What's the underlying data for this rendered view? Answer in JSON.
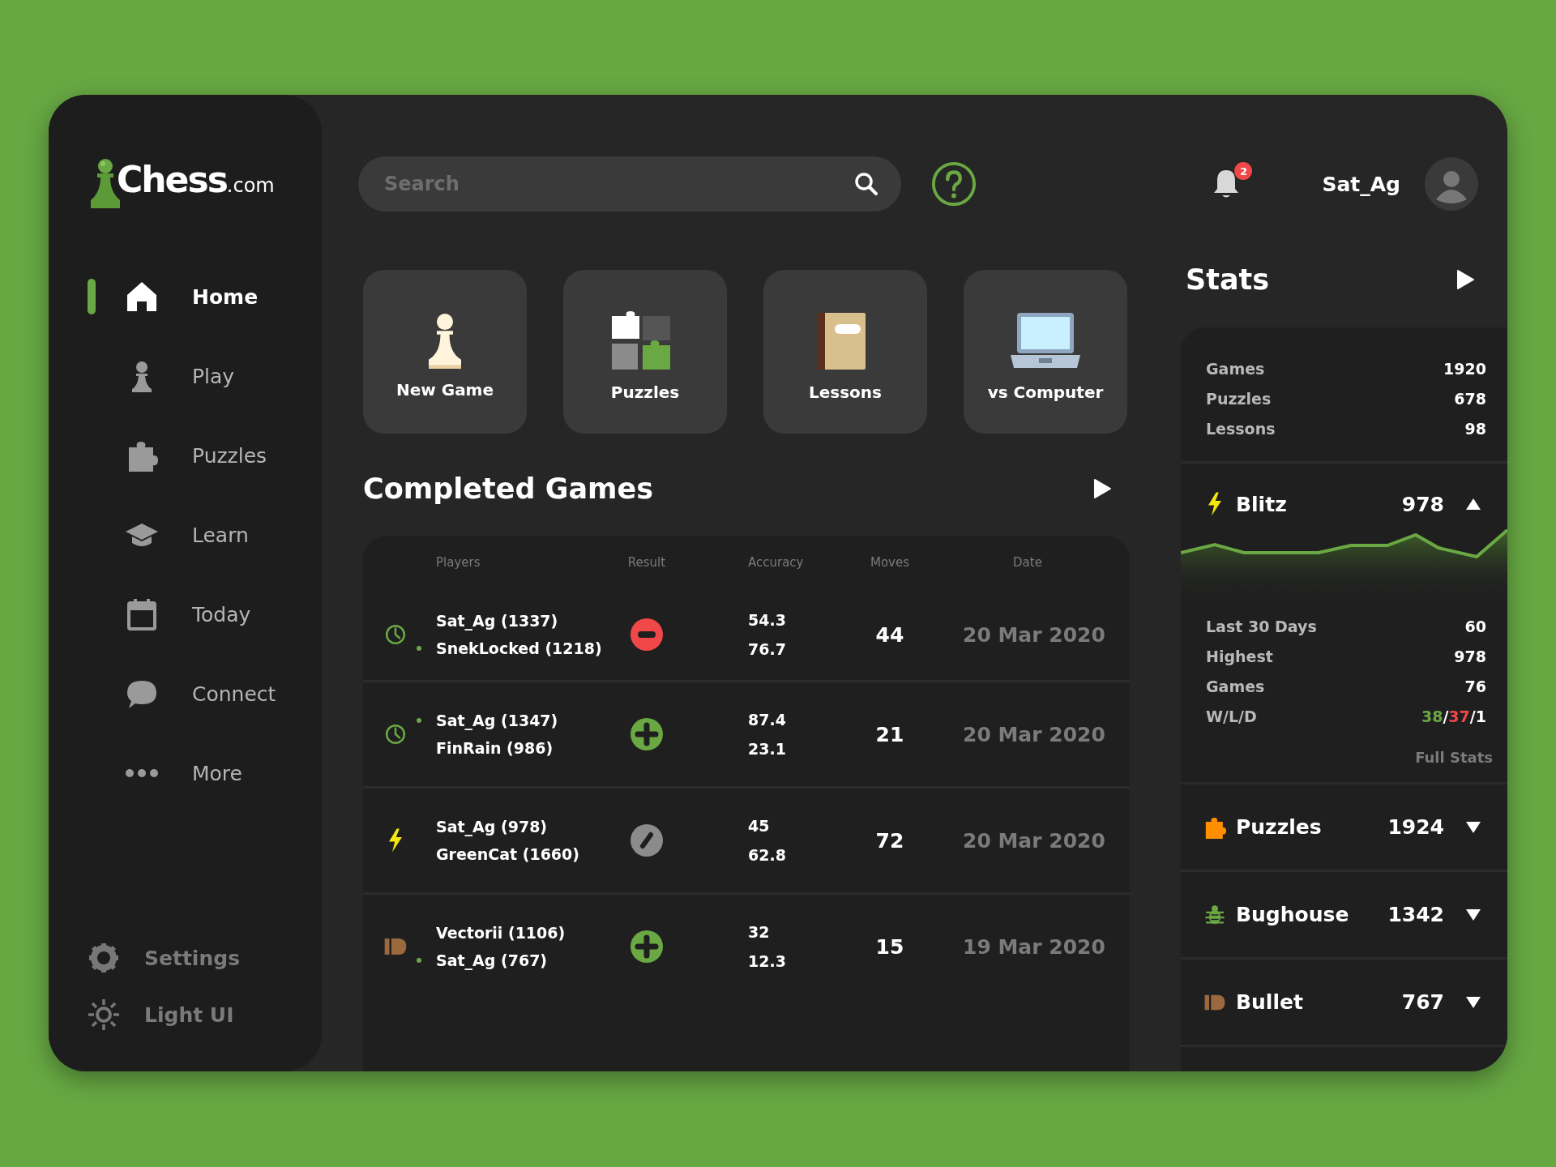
{
  "logo": {
    "name": "Chess",
    "suffix": ".com"
  },
  "nav": [
    {
      "label": "Home",
      "selected": true
    },
    {
      "label": "Play",
      "selected": false
    },
    {
      "label": "Puzzles",
      "selected": false
    },
    {
      "label": "Learn",
      "selected": false
    },
    {
      "label": "Today",
      "selected": false
    },
    {
      "label": "Connect",
      "selected": false
    },
    {
      "label": "More",
      "selected": false
    }
  ],
  "footer_nav": [
    {
      "label": "Settings"
    },
    {
      "label": "Light UI"
    }
  ],
  "search": {
    "placeholder": "Search"
  },
  "notifications": {
    "count": "2"
  },
  "user": {
    "name": "Sat_Ag"
  },
  "quick_actions": [
    {
      "label": "New Game"
    },
    {
      "label": "Puzzles"
    },
    {
      "label": "Lessons"
    },
    {
      "label": "vs Computer"
    }
  ],
  "completed_games": {
    "title": "Completed Games",
    "columns": [
      "Players",
      "Result",
      "Accuracy",
      "Moves",
      "Date"
    ],
    "rows": [
      {
        "kind": "rapid",
        "players": [
          {
            "name": "Sat_Ag (1337)",
            "marked": false
          },
          {
            "name": "SnekLocked (1218)",
            "marked": true
          }
        ],
        "result": {
          "kind": "loss"
        },
        "accuracy": [
          "54.3",
          "76.7"
        ],
        "moves": "44",
        "date": "20 Mar 2020"
      },
      {
        "kind": "rapid",
        "players": [
          {
            "name": "Sat_Ag (1347)",
            "marked": true
          },
          {
            "name": "FinRain (986)",
            "marked": false
          }
        ],
        "result": {
          "kind": "win"
        },
        "accuracy": [
          "87.4",
          "23.1"
        ],
        "moves": "21",
        "date": "20 Mar 2020"
      },
      {
        "kind": "blitz",
        "players": [
          {
            "name": "Sat_Ag (978)",
            "marked": false
          },
          {
            "name": "GreenCat (1660)",
            "marked": false
          }
        ],
        "result": {
          "kind": "draw"
        },
        "accuracy": [
          "45",
          "62.8"
        ],
        "moves": "72",
        "date": "20 Mar 2020"
      },
      {
        "kind": "bullet",
        "players": [
          {
            "name": "Vectorii (1106)",
            "marked": false
          },
          {
            "name": "Sat_Ag (767)",
            "marked": true
          }
        ],
        "result": {
          "kind": "win"
        },
        "accuracy": [
          "32",
          "12.3"
        ],
        "moves": "15",
        "date": "19 Mar 2020"
      }
    ]
  },
  "stats": {
    "title": "Stats",
    "summary": [
      {
        "label": "Games",
        "value": "1920"
      },
      {
        "label": "Puzzles",
        "value": "678"
      },
      {
        "label": "Lessons",
        "value": "98"
      }
    ],
    "modes": [
      {
        "kind": "blitz",
        "name": "Blitz",
        "rating": "978",
        "expanded": true,
        "details": [
          {
            "label": "Last 30 Days",
            "value": "60"
          },
          {
            "label": "Highest",
            "value": "978"
          },
          {
            "label": "Games",
            "value": "76"
          },
          {
            "label": "W/L/D",
            "parts": [
              {
                "text": "38",
                "color": "#6aa843"
              },
              {
                "text": "/",
                "color": "#ffffff"
              },
              {
                "text": "37",
                "color": "#f04848"
              },
              {
                "text": "/",
                "color": "#ffffff"
              },
              {
                "text": "1",
                "color": "#ffffff"
              }
            ]
          }
        ],
        "link": "Full Stats"
      },
      {
        "kind": "puzzles",
        "name": "Puzzles",
        "rating": "1924",
        "expanded": false
      },
      {
        "kind": "bughouse",
        "name": "Bughouse",
        "rating": "1342",
        "expanded": false
      },
      {
        "kind": "bullet",
        "name": "Bullet",
        "rating": "767",
        "expanded": false
      }
    ]
  }
}
